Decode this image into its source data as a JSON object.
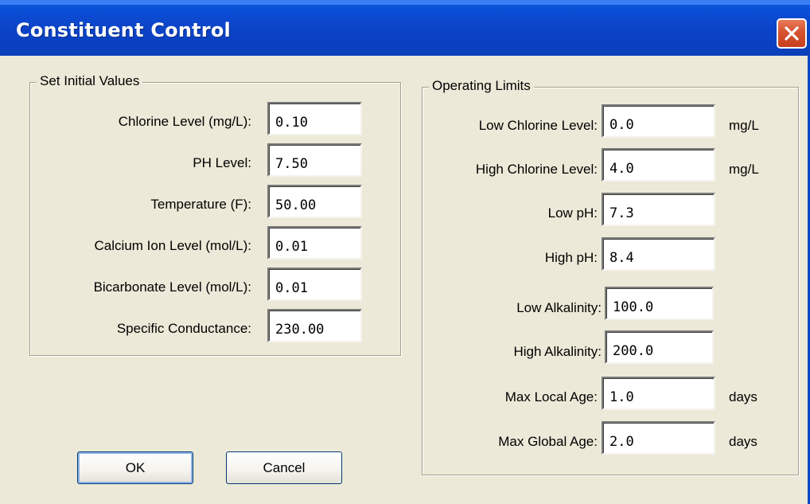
{
  "window": {
    "title": "Constituent Control"
  },
  "initial": {
    "legend": "Set Initial Values",
    "fields": [
      {
        "label": "Chlorine Level (mg/L):",
        "value": "0.10"
      },
      {
        "label": "PH Level:",
        "value": "7.50"
      },
      {
        "label": "Temperature (F):",
        "value": "50.00"
      },
      {
        "label": "Calcium Ion Level (mol/L):",
        "value": "0.01"
      },
      {
        "label": "Bicarbonate Level (mol/L):",
        "value": "0.01"
      },
      {
        "label": "Specific Conductance:",
        "value": "230.00"
      }
    ]
  },
  "limits": {
    "legend": "Operating Limits",
    "fields": [
      {
        "label": "Low Chlorine Level:",
        "value": "0.0",
        "unit": "mg/L"
      },
      {
        "label": "High Chlorine Level:",
        "value": "4.0",
        "unit": "mg/L"
      },
      {
        "label": "Low pH:",
        "value": "7.3",
        "unit": ""
      },
      {
        "label": "High pH:",
        "value": "8.4",
        "unit": ""
      },
      {
        "label": "Low Alkalinity:",
        "value": "100.0",
        "unit": ""
      },
      {
        "label": "High Alkalinity:",
        "value": "200.0",
        "unit": ""
      },
      {
        "label": "Max Local Age:",
        "value": "1.0",
        "unit": "days"
      },
      {
        "label": "Max Global Age:",
        "value": "2.0",
        "unit": "days"
      }
    ]
  },
  "buttons": {
    "ok": "OK",
    "cancel": "Cancel"
  },
  "icons": {
    "close": "close-icon"
  },
  "colors": {
    "titlebar": "#0a4ed6",
    "close": "#d5532f",
    "face": "#ece9d8"
  }
}
